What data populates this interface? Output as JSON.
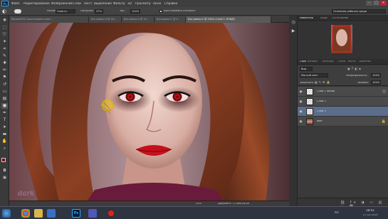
{
  "app": {
    "logo": "Ps"
  },
  "menu": [
    "Файл",
    "Редактирование",
    "Изображение",
    "Слои",
    "Текст",
    "Выделение",
    "Фильтр",
    "3D",
    "Просмотр",
    "Окно",
    "Справка"
  ],
  "options": {
    "mode_label": "Режим:",
    "mode_value": "Осветл.",
    "exposure_label": "Нагрузка:",
    "exposure_value": "37%",
    "strength_label": "Эф.:",
    "strength_value": "100%",
    "protect_label": "Восстановить контраст",
    "workspace": "Основная рабочая среда"
  },
  "tabs": [
    "Bataan9701 восстановить цвет...",
    "Без имени-4 @ 18...",
    "Без имени-5 @ 10...",
    "Без имени-1 @ 5...",
    "Без имени-2 @ 200% (Слой 2, RGB/8)"
  ],
  "tools": [
    "move-icon",
    "marquee-icon",
    "lasso-icon",
    "magic-wand-icon",
    "crop-icon",
    "eyedropper-icon",
    "healing-icon",
    "brush-icon",
    "stamp-icon",
    "history-brush-icon",
    "eraser-icon",
    "gradient-icon",
    "dodge-icon",
    "pen-icon",
    "type-icon",
    "path-select-icon",
    "shape-icon",
    "hand-icon",
    "zoom-icon"
  ],
  "panels": {
    "top_tabs": [
      "Навигатор",
      "Инфо",
      "Гистограмма"
    ],
    "layer_tabs": [
      "Слои",
      "Каналы",
      "Контуры",
      "Стили",
      "Кисти",
      "Свойства"
    ],
    "kind_label": "Вид",
    "blend_mode": "Мягкий свет",
    "opacity_label": "Непрозрачность:",
    "opacity_value": "100%",
    "lock_label": "Закрепить:",
    "fill_label": "Заливка:",
    "fill_value": "100%",
    "layers": [
      {
        "name": "Слой 1 копия",
        "selected": false,
        "thumb": "checker"
      },
      {
        "name": "Слой 2",
        "selected": false,
        "thumb": "checker"
      },
      {
        "name": "Слой 3",
        "selected": true,
        "thumb": "checker"
      },
      {
        "name": "Фон",
        "selected": false,
        "thumb": "photo"
      }
    ]
  },
  "status": {
    "zoom": "25%",
    "doc": "Документ: 2,29М/16,5М"
  },
  "canvas": {
    "watermark": "dark"
  },
  "taskbar": {
    "time": "18:43",
    "date": "27.12.2015",
    "lang": "RU",
    "apps": [
      "start-icon",
      "chrome-icon",
      "explorer-icon",
      "media-player-icon",
      "photoshop-icon",
      "media-icon",
      "record-icon"
    ]
  },
  "colors": {
    "accent": "#31a8ff",
    "selection": "#5a6e8c"
  }
}
